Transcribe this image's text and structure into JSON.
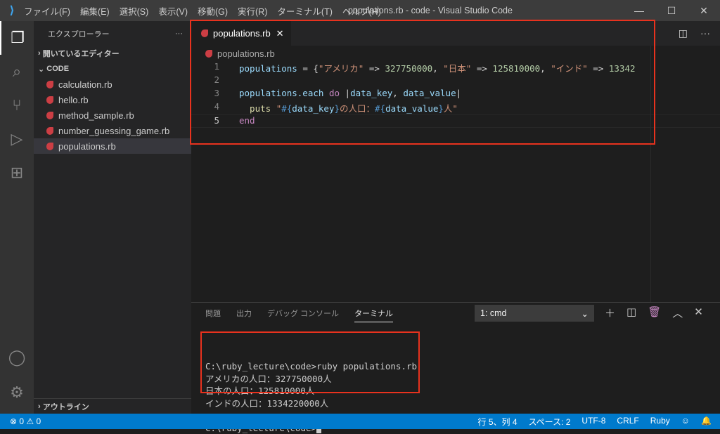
{
  "titlebar": {
    "menu": [
      "ファイル(F)",
      "編集(E)",
      "選択(S)",
      "表示(V)",
      "移動(G)",
      "実行(R)",
      "ターミナル(T)",
      "ヘルプ(H)"
    ],
    "title": "populations.rb - code - Visual Studio Code"
  },
  "sidebar": {
    "header": "エクスプローラー",
    "more": "···",
    "open_editors": "開いているエディター",
    "folder": "CODE",
    "files": [
      "calculation.rb",
      "hello.rb",
      "method_sample.rb",
      "number_guessing_game.rb",
      "populations.rb"
    ],
    "outline": "アウトライン"
  },
  "editor": {
    "tab": "populations.rb",
    "breadcrumb": "populations.rb",
    "line_numbers": [
      "1",
      "2",
      "3",
      "4",
      "5"
    ],
    "l1": [
      "populations",
      " = {",
      "\"アメリカ\"",
      " => ",
      "327750000",
      ", ",
      "\"日本\"",
      " => ",
      "125810000",
      ", ",
      "\"インド\"",
      " => ",
      "13342"
    ],
    "l3": [
      "populations.each ",
      "do",
      " |",
      "data_key",
      ", ",
      "data_value",
      "|"
    ],
    "l4": [
      "  puts ",
      "\"",
      "#{",
      "data_key",
      "}",
      "の人口：",
      "#{",
      "data_value",
      "}",
      "人\""
    ],
    "l5": "end"
  },
  "panel": {
    "tabs": [
      "問題",
      "出力",
      "デバッグ コンソール",
      "ターミナル"
    ],
    "terminal_select": "1: cmd",
    "terminal_lines": [
      "C:\\ruby_lecture\\code>ruby populations.rb",
      "アメリカの人口：327750000人",
      "日本の人口：125810000人",
      "インドの人口：1334220000人",
      "",
      "C:\\ruby_lecture\\code>"
    ]
  },
  "status": {
    "errors": "0",
    "warnings": "0",
    "position": "行 5、列 4",
    "spaces": "スペース: 2",
    "encoding": "UTF-8",
    "eol": "CRLF",
    "language": "Ruby"
  },
  "colors": {
    "accent": "#007acc",
    "highlight": "#e8321e",
    "ruby": "#cc3e44"
  }
}
